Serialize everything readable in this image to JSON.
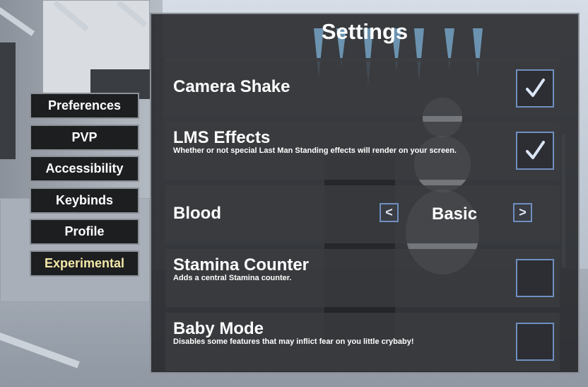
{
  "sidebar": {
    "tabs": [
      {
        "label": "Preferences"
      },
      {
        "label": "PVP"
      },
      {
        "label": "Accessibility"
      },
      {
        "label": "Keybinds"
      },
      {
        "label": "Profile"
      },
      {
        "label": "Experimental"
      }
    ],
    "active_tab": "Experimental"
  },
  "panel": {
    "title": "Settings",
    "rows": {
      "camera_shake": {
        "label": "Camera Shake",
        "checked": true
      },
      "lms_effects": {
        "label": "LMS Effects",
        "description": "Whether or not special Last Man Standing effects will render on your screen.",
        "checked": true
      },
      "blood": {
        "label": "Blood",
        "value": "Basic",
        "prev": "<",
        "next": ">"
      },
      "stamina_counter": {
        "label": "Stamina Counter",
        "description": "Adds a central Stamina counter.",
        "checked": false
      },
      "baby_mode": {
        "label": "Baby Mode",
        "description": "Disables some features that may inflict fear on you little crybaby!",
        "checked": false
      }
    }
  },
  "colors": {
    "panel_bg": "#202124",
    "border": "#8c9097",
    "active_tab_text": "#f3e8a8",
    "checkbox_border": "#6f8fc0",
    "checkmark": "#dbe6f7"
  },
  "icons": {
    "checkmark": "checkmark-icon",
    "prev": "chevron-left-icon",
    "next": "chevron-right-icon"
  }
}
